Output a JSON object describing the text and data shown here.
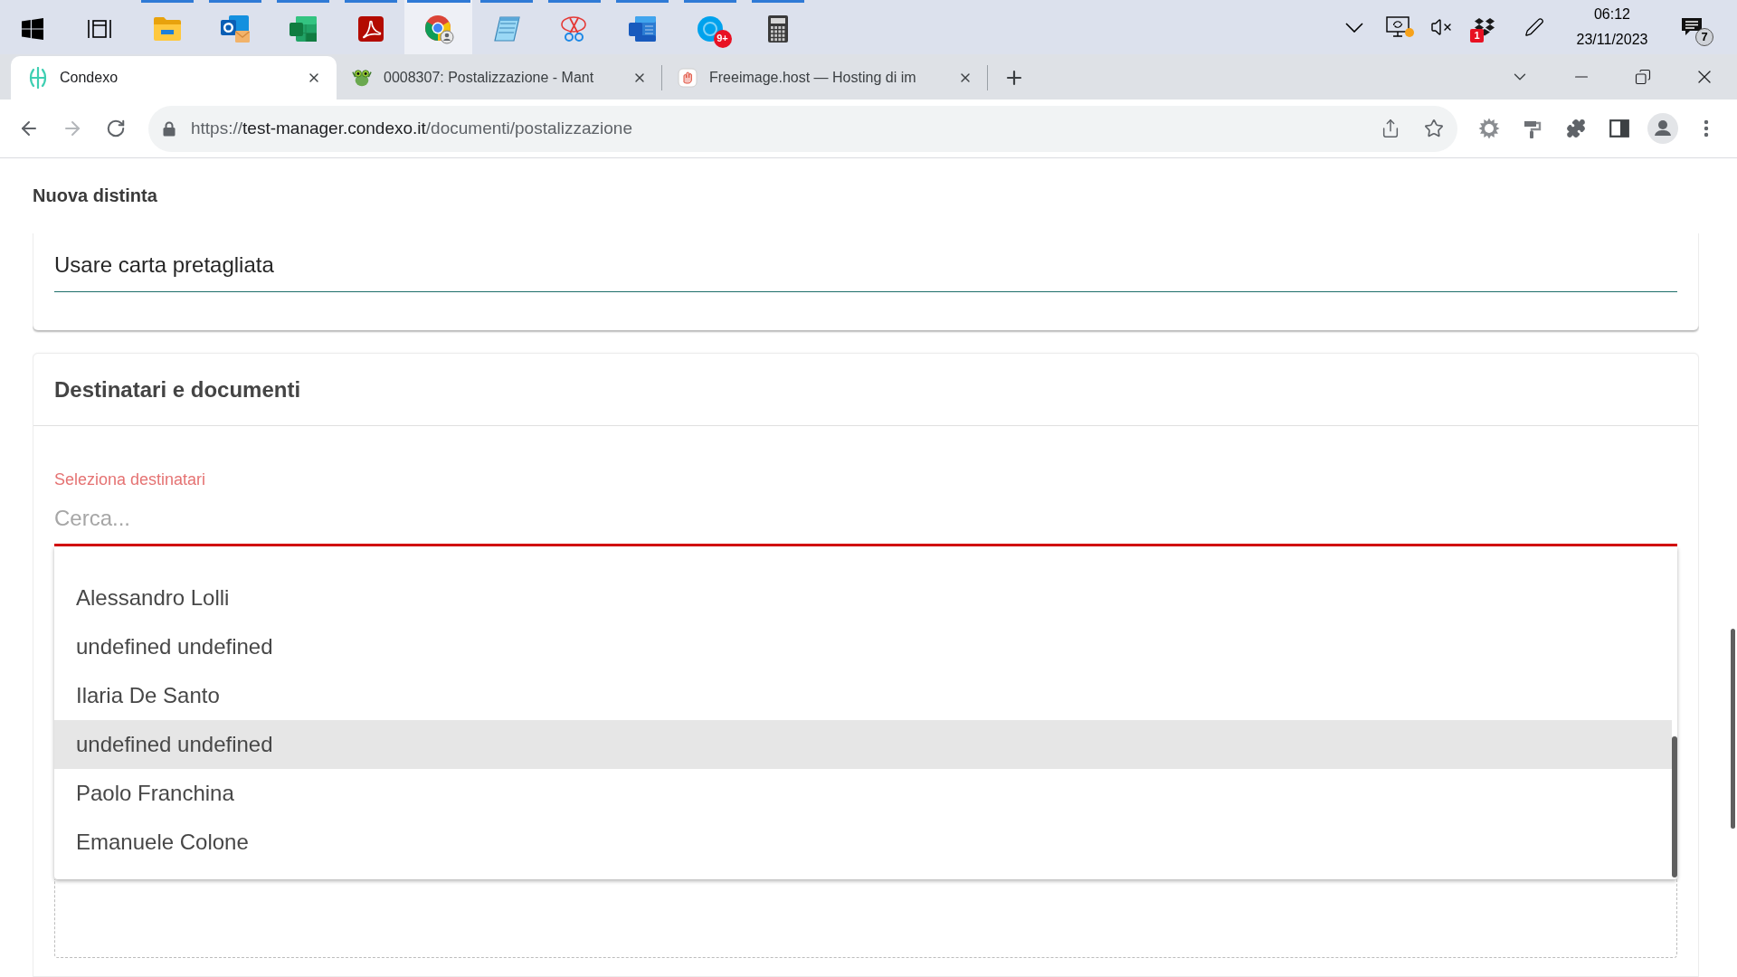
{
  "taskbar": {
    "apps": [
      {
        "kind": "start",
        "running": false,
        "active": false
      },
      {
        "kind": "taskview",
        "running": false,
        "active": false
      },
      {
        "kind": "explorer",
        "running": true,
        "active": false
      },
      {
        "kind": "outlook",
        "running": true,
        "active": false
      },
      {
        "kind": "excel",
        "running": true,
        "active": false
      },
      {
        "kind": "acrobat",
        "running": true,
        "active": false
      },
      {
        "kind": "chrome",
        "running": true,
        "active": true
      },
      {
        "kind": "notepad",
        "running": true,
        "active": false
      },
      {
        "kind": "snipping",
        "running": true,
        "active": false
      },
      {
        "kind": "word",
        "running": true,
        "active": false
      },
      {
        "kind": "skype",
        "running": true,
        "active": false,
        "badge": "9+"
      },
      {
        "kind": "calculator",
        "running": true,
        "active": false
      }
    ],
    "tray": [
      {
        "kind": "chevron"
      },
      {
        "kind": "display",
        "alert": true
      },
      {
        "kind": "volume",
        "muted": true
      },
      {
        "kind": "dropbox",
        "badge": "1"
      },
      {
        "kind": "pen"
      }
    ],
    "clock": {
      "time": "06:12",
      "date": "23/11/2023"
    },
    "notifications": {
      "count": "7"
    }
  },
  "browser": {
    "tabs": [
      {
        "kind": "condexo",
        "title": "Condexo",
        "selected": true
      },
      {
        "kind": "mantis",
        "title": "0008307: Postalizzazione - Mant",
        "selected": false
      },
      {
        "kind": "freeimage",
        "title": "Freeimage.host — Hosting di im",
        "selected": false
      }
    ],
    "nav": [
      {
        "kind": "back",
        "disabled": false
      },
      {
        "kind": "forward",
        "disabled": true
      },
      {
        "kind": "reload",
        "disabled": false
      }
    ],
    "address": {
      "scheme": "https://",
      "host": "test-manager.condexo.it",
      "path": "/documenti/postalizzazione"
    }
  },
  "page": {
    "title": "Nuova distinta",
    "print_card": {
      "value": "Usare carta pretagliata"
    },
    "recipients_card": {
      "title": "Destinatari e documenti",
      "field": {
        "label": "Seleziona destinatari",
        "placeholder": "Cerca...",
        "invalid": true
      },
      "options": [
        {
          "label": "Alessandro Lolli",
          "selected": false
        },
        {
          "label": "undefined undefined",
          "selected": false
        },
        {
          "label": "Ilaria De Santo",
          "selected": false
        },
        {
          "label": "undefined undefined",
          "selected": true
        },
        {
          "label": "Paolo Franchina",
          "selected": false
        },
        {
          "label": "Emanuele Colone",
          "selected": false
        }
      ]
    }
  }
}
